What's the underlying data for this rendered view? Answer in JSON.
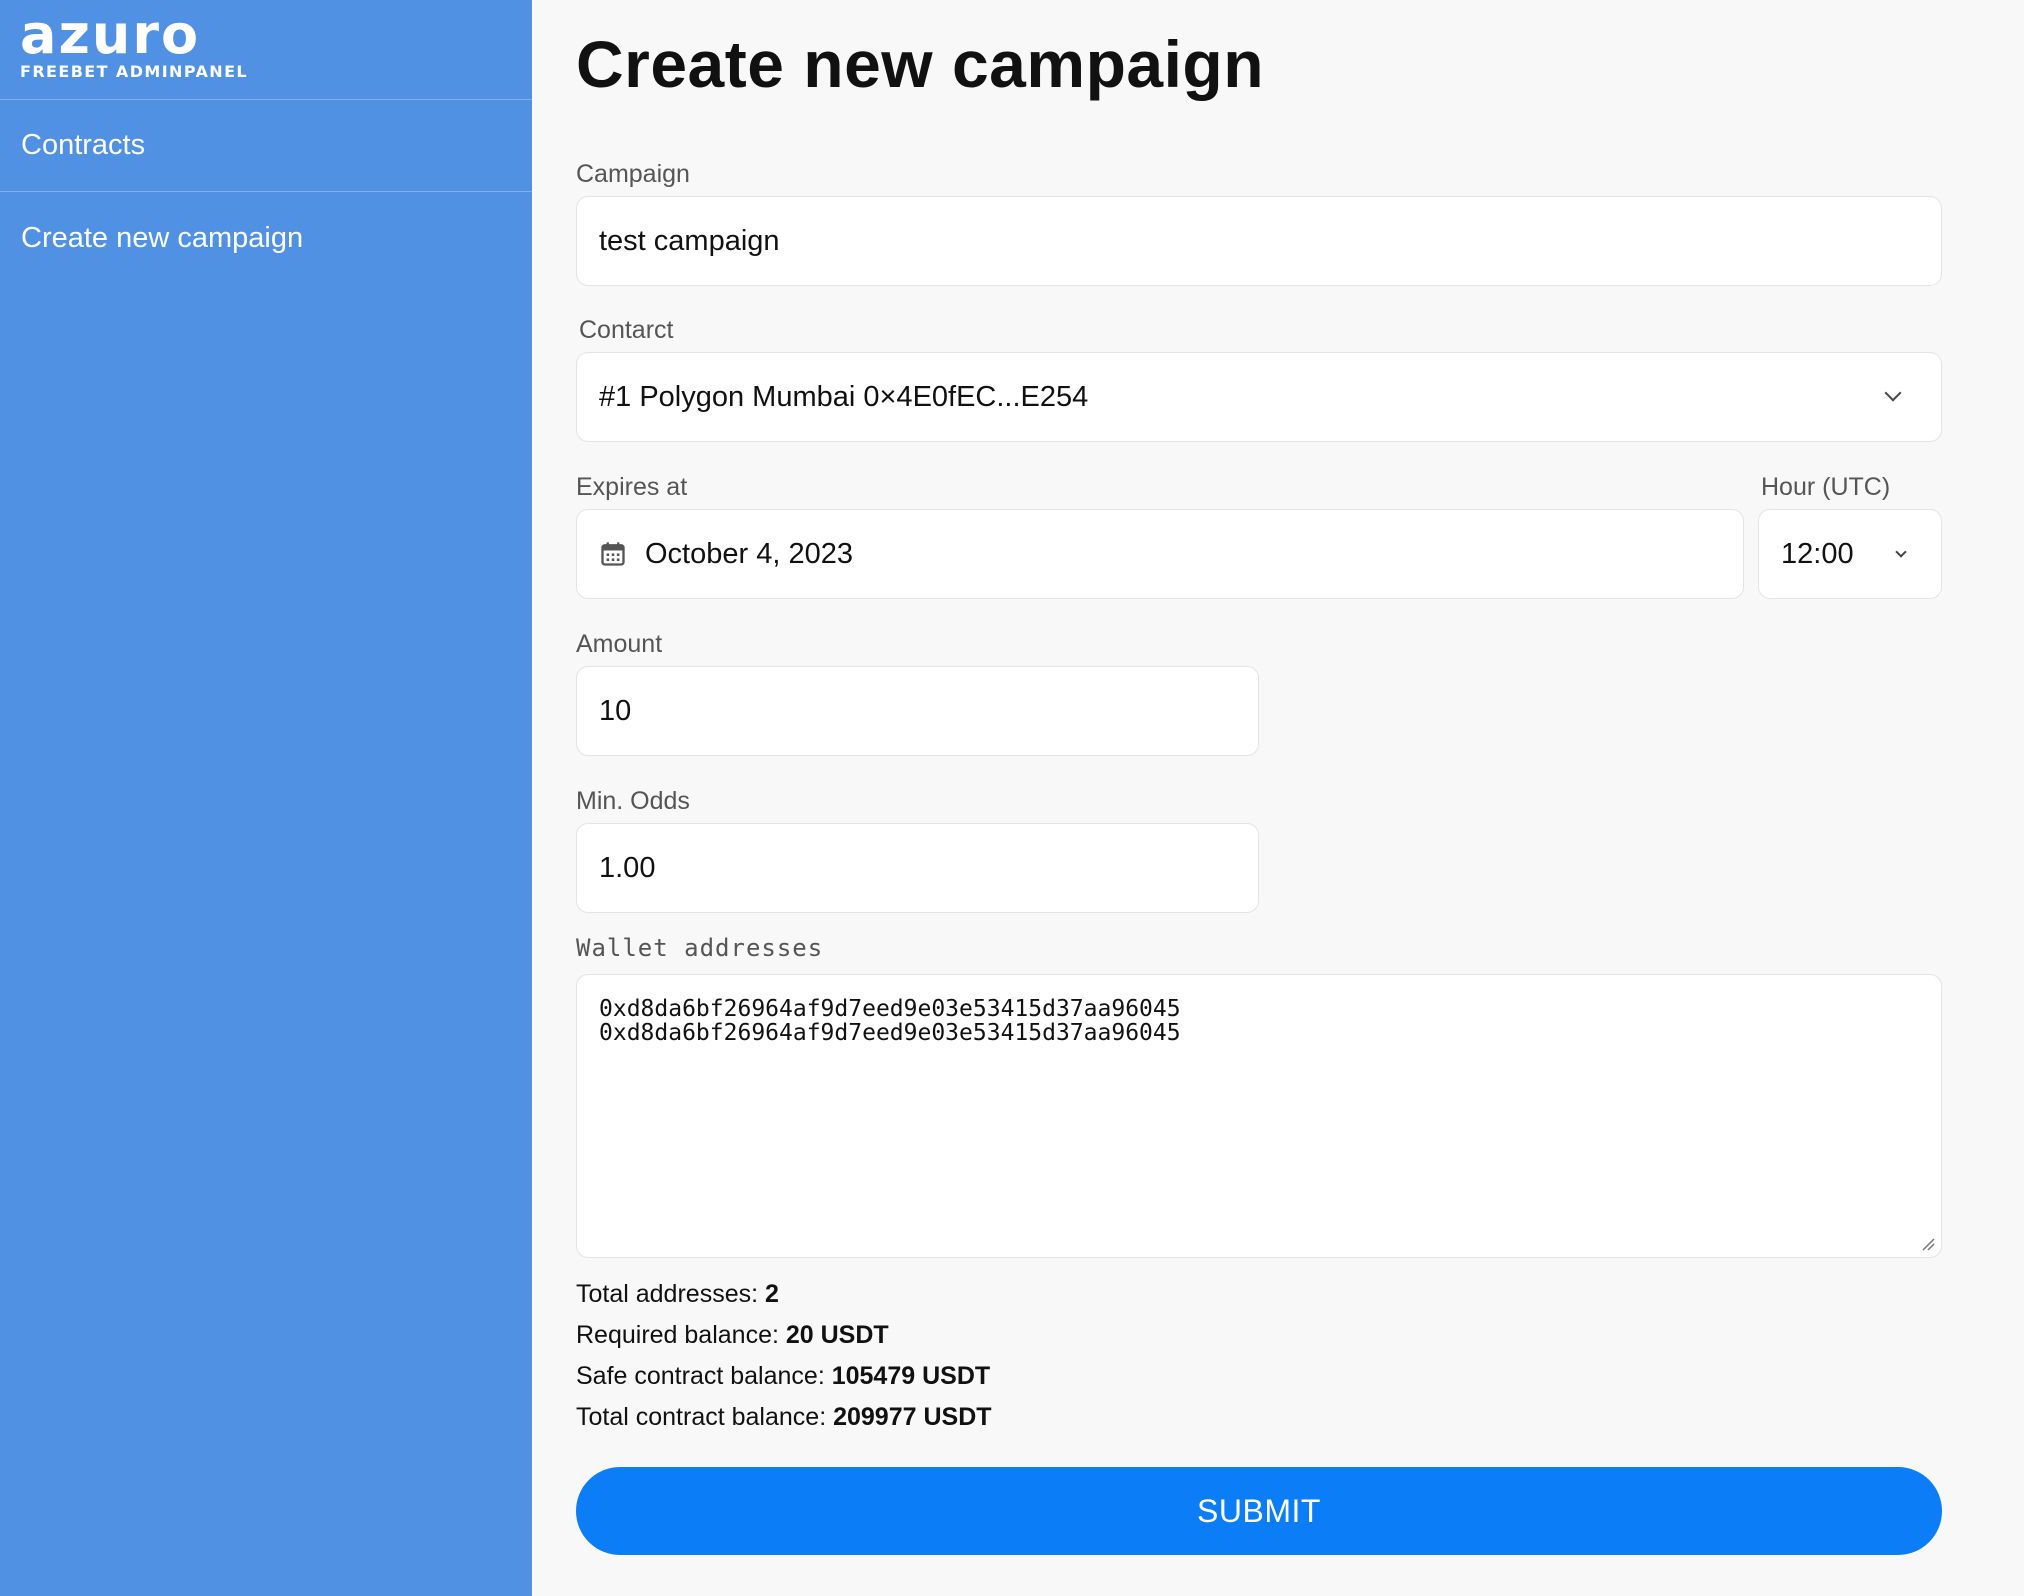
{
  "brand": {
    "logo_text": "azuro",
    "subtitle": "FREEBET ADMINPANEL"
  },
  "sidebar": {
    "items": [
      {
        "label": "Contracts"
      },
      {
        "label": "Create new campaign"
      }
    ]
  },
  "page": {
    "title": "Create new campaign"
  },
  "form": {
    "campaign": {
      "label": "Campaign",
      "value": "test campaign"
    },
    "contract": {
      "label": "Contarct",
      "value": "#1 Polygon Mumbai 0×4E0fEC...E254"
    },
    "expires": {
      "label": "Expires at",
      "value": "October 4, 2023",
      "icon": "calendar-icon"
    },
    "hour": {
      "label": "Hour (UTC)",
      "value": "12:00"
    },
    "amount": {
      "label": "Amount",
      "value": "10"
    },
    "min_odds": {
      "label": "Min. Odds",
      "value": "1.00"
    },
    "wallets": {
      "label": "Wallet addresses",
      "lines": [
        "0xd8da6bf26964af9d7eed9e03e53415d37aa96045",
        "0xd8da6bf26964af9d7eed9e03e53415d37aa96045"
      ]
    }
  },
  "summary": {
    "total_addresses_label": "Total addresses: ",
    "total_addresses_value": "2",
    "required_balance_label": "Required balance: ",
    "required_balance_value": "20 USDT",
    "safe_balance_label": "Safe contract balance: ",
    "safe_balance_value": "105479 USDT",
    "total_balance_label": "Total contract balance: ",
    "total_balance_value": "209977 USDT"
  },
  "actions": {
    "submit_label": "SUBMIT"
  },
  "colors": {
    "sidebar_bg": "#5091e3",
    "accent": "#0a7df7",
    "page_bg": "#f8f8f8"
  }
}
